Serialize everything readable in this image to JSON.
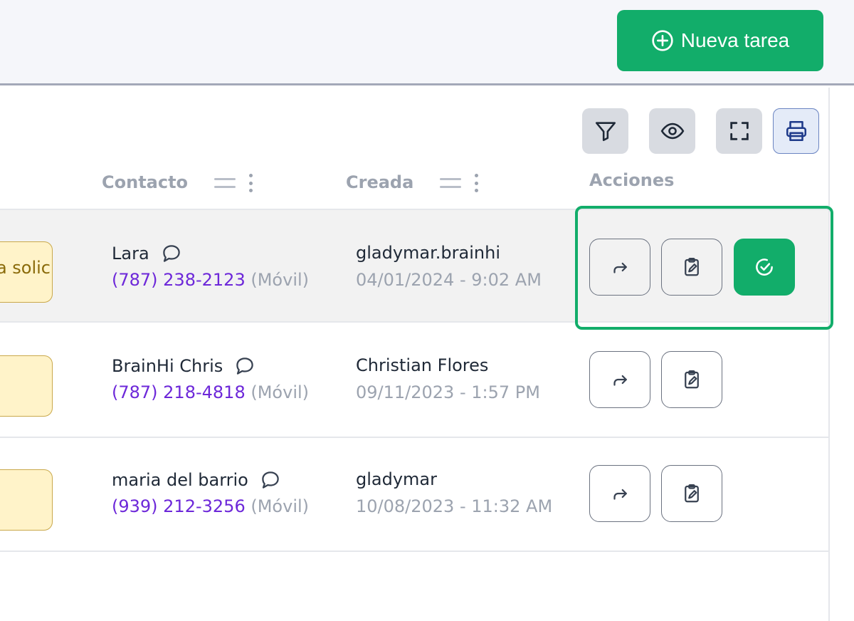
{
  "header": {
    "new_task_label": "Nueva tarea"
  },
  "toolbar": {
    "icons": [
      "filter-icon",
      "eye-icon",
      "fullscreen-icon",
      "printer-icon"
    ]
  },
  "columns": {
    "contact": "Contacto",
    "created": "Creada",
    "actions": "Acciones"
  },
  "rows": [
    {
      "status": "a solic",
      "contact_name": "Lara",
      "phone": "(787) 238-2123",
      "phone_type": "(Móvil)",
      "creator": "gladymar.brainhi",
      "created": "04/01/2024 - 9:02 AM"
    },
    {
      "status": "",
      "contact_name": "BrainHi Chris",
      "phone": "(787) 218-4818",
      "phone_type": "(Móvil)",
      "creator": "Christian Flores",
      "created": "09/11/2023 - 1:57 PM"
    },
    {
      "status": "",
      "contact_name": "maria del barrio",
      "phone": "(939) 212-3256",
      "phone_type": "(Móvil)",
      "creator": "gladymar",
      "created": "10/08/2023 - 11:32 AM"
    }
  ],
  "colors": {
    "accent_green": "#12ad6a",
    "phone_purple": "#6d28d9",
    "badge_yellow": "#fff3c9"
  }
}
